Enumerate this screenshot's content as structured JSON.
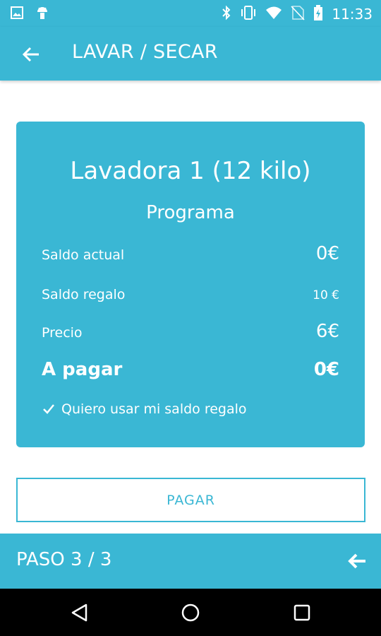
{
  "status_bar": {
    "time": "11:33",
    "left_icons": [
      "image-icon",
      "android-icon"
    ],
    "right_icons": [
      "bluetooth-icon",
      "vibrate-icon",
      "wifi-icon",
      "no-sim-icon",
      "battery-icon"
    ]
  },
  "toolbar": {
    "title": "LAVAR / SECAR",
    "back_icon": "arrow-left-icon"
  },
  "card": {
    "title": "Lavadora 1 (12 kilo)",
    "subtitle": "Programa",
    "rows": [
      {
        "label": "Saldo actual",
        "value": "0€"
      },
      {
        "label": "Saldo regalo",
        "value": "10 €"
      },
      {
        "label": "Precio",
        "value": "6€"
      },
      {
        "label": "A pagar",
        "value": "0€"
      }
    ],
    "checkbox_label": "Quiero usar mi saldo regalo",
    "checkbox_checked": true
  },
  "pay_button": {
    "label": "PAGAR"
  },
  "step_bar": {
    "label": "PASO 3 / 3",
    "icon": "arrow-left-icon"
  },
  "nav_bar": {
    "icons": [
      "back-triangle-icon",
      "home-circle-icon",
      "recents-square-icon"
    ]
  },
  "colors": {
    "accent": "#3ab7d4",
    "nav_background": "#000000",
    "background": "#ffffff"
  }
}
